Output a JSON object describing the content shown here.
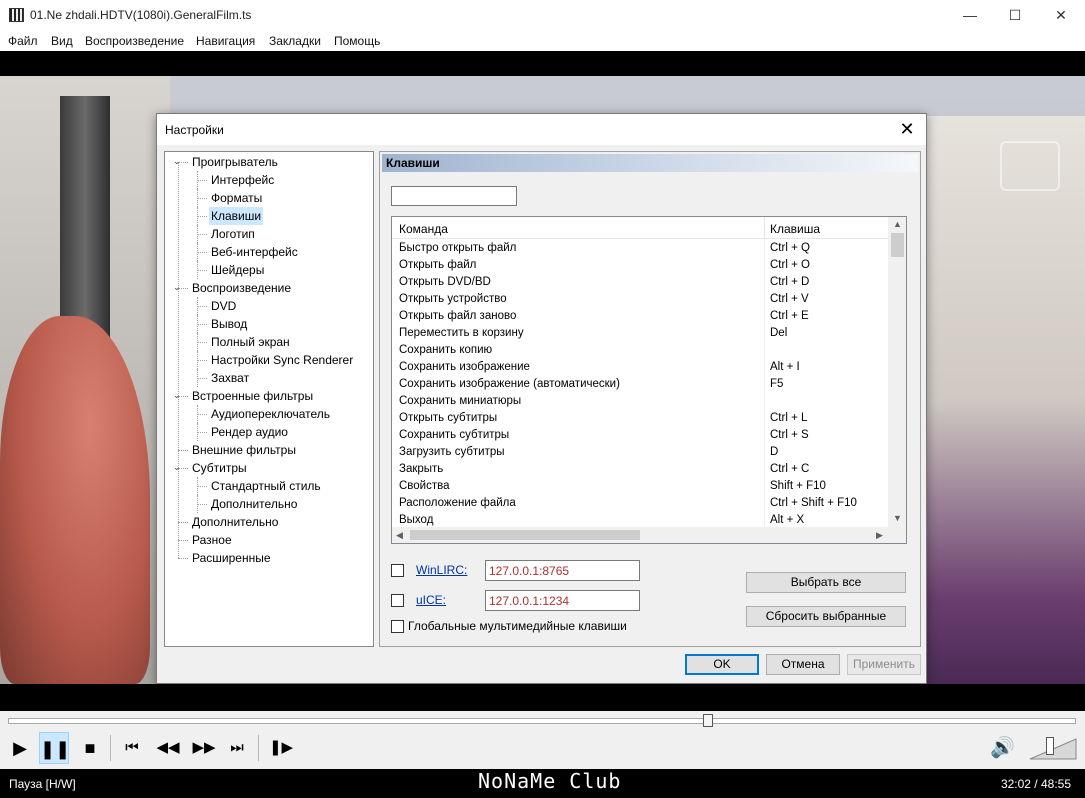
{
  "window": {
    "title": "01.Ne zhdali.HDTV(1080i).GeneralFilm.ts",
    "minimize_glyph": "—",
    "maximize_glyph": "☐",
    "close_glyph": "✕"
  },
  "menu": [
    "Файл",
    "Вид",
    "Воспроизведение",
    "Навигация",
    "Закладки",
    "Помощь"
  ],
  "dialog": {
    "title": "Настройки",
    "close_glyph": "✕",
    "tree": [
      {
        "label": "Проигрыватель",
        "level": 0,
        "expanded": true
      },
      {
        "label": "Интерфейс",
        "level": 1
      },
      {
        "label": "Форматы",
        "level": 1
      },
      {
        "label": "Клавиши",
        "level": 1,
        "selected": true
      },
      {
        "label": "Логотип",
        "level": 1
      },
      {
        "label": "Веб-интерфейс",
        "level": 1
      },
      {
        "label": "Шейдеры",
        "level": 1
      },
      {
        "label": "Воспроизведение",
        "level": 0,
        "expanded": true
      },
      {
        "label": "DVD",
        "level": 1
      },
      {
        "label": "Вывод",
        "level": 1
      },
      {
        "label": "Полный экран",
        "level": 1
      },
      {
        "label": "Настройки Sync Renderer",
        "level": 1
      },
      {
        "label": "Захват",
        "level": 1
      },
      {
        "label": "Встроенные фильтры",
        "level": 0,
        "expanded": true
      },
      {
        "label": "Аудиопереключатель",
        "level": 1
      },
      {
        "label": "Рендер аудио",
        "level": 1
      },
      {
        "label": "Внешние фильтры",
        "level": 0
      },
      {
        "label": "Субтитры",
        "level": 0,
        "expanded": true
      },
      {
        "label": "Стандартный стиль",
        "level": 1
      },
      {
        "label": "Дополнительно",
        "level": 1
      },
      {
        "label": "Дополнительно",
        "level": 0
      },
      {
        "label": "Разное",
        "level": 0
      },
      {
        "label": "Расширенные",
        "level": 0
      }
    ],
    "panel": {
      "header": "Клавиши",
      "filter_value": "",
      "columns": {
        "command": "Команда",
        "key": "Клавиша"
      },
      "rows": [
        {
          "command": "Быстро открыть файл",
          "key": "Ctrl + Q"
        },
        {
          "command": "Открыть файл",
          "key": "Ctrl + O"
        },
        {
          "command": "Открыть DVD/BD",
          "key": "Ctrl + D"
        },
        {
          "command": "Открыть устройство",
          "key": "Ctrl + V"
        },
        {
          "command": "Открыть файл заново",
          "key": "Ctrl + E"
        },
        {
          "command": "Переместить в корзину",
          "key": "Del"
        },
        {
          "command": "Сохранить копию",
          "key": ""
        },
        {
          "command": "Сохранить изображение",
          "key": "Alt + I"
        },
        {
          "command": "Сохранить изображение (автоматически)",
          "key": "F5"
        },
        {
          "command": "Сохранить миниатюры",
          "key": ""
        },
        {
          "command": "Открыть субтитры",
          "key": "Ctrl + L"
        },
        {
          "command": "Сохранить субтитры",
          "key": "Ctrl + S"
        },
        {
          "command": "Загрузить субтитры",
          "key": "D"
        },
        {
          "command": "Закрыть",
          "key": "Ctrl + C"
        },
        {
          "command": "Свойства",
          "key": "Shift + F10"
        },
        {
          "command": "Расположение файла",
          "key": "Ctrl + Shift + F10"
        },
        {
          "command": "Выход",
          "key": "Alt + X"
        }
      ],
      "winlirc_label": "WinLIRC:",
      "winlirc_address": "127.0.0.1:8765",
      "uice_label": "uICE:",
      "uice_address": "127.0.0.1:1234",
      "global_keys_label": "Глобальные мультимедийные клавиши",
      "select_all_label": "Выбрать все",
      "reset_selected_label": "Сбросить выбранные"
    },
    "ok_label": "OK",
    "cancel_label": "Отмена",
    "apply_label": "Применить"
  },
  "player": {
    "seek_position": 0.655,
    "buttons": [
      "play",
      "pause",
      "stop",
      "prev",
      "rewind",
      "forward",
      "next",
      "frame-step"
    ],
    "active_button": "pause",
    "volume": 0.35
  },
  "status": {
    "state": "Пауза [H/W]",
    "logo": "NoNaMe Club",
    "time": "32:02 / 48:55"
  }
}
